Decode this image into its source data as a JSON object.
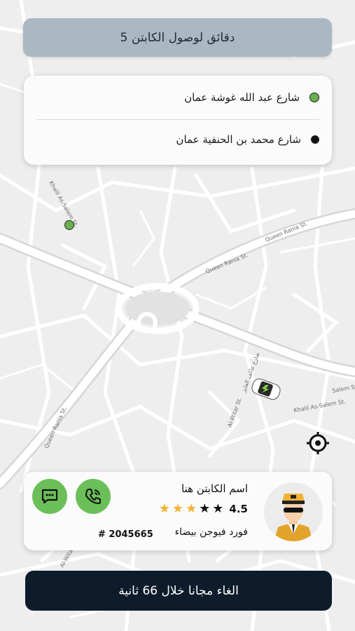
{
  "eta_banner": {
    "text": "5 دقائق لوصول الكابتن"
  },
  "route": {
    "pickup": "شارع عبد الله غوشة عمان",
    "dropoff": "شارع محمد بن الحنفية عمان"
  },
  "map": {
    "streets": [
      "Queen Rania St.",
      "Queen Rania St.",
      "Queen Rania St.",
      "Khalil As-Salem St.",
      "Khalil As-Salem St.",
      "Al-Witar St.",
      "Al-Witar St.",
      "شارع عاكف الفايز",
      "Salem St."
    ],
    "colors": {
      "road": "#ffffff",
      "block": "#ececec",
      "highway": "#dcdcdc"
    }
  },
  "captain": {
    "name": "اسم الكابتن هنا",
    "rating": "4.5",
    "stars": {
      "filled_gold": 3,
      "filled_dark": 2
    },
    "car": "فورد فيوجن بيضاء",
    "plate": "# 2045665"
  },
  "actions": {
    "chat_icon": "chat-icon",
    "call_icon": "phone-icon",
    "locate_icon": "crosshair-icon"
  },
  "cancel_button": {
    "label": "الغاء مجانا خلال 66 ثانية"
  },
  "colors": {
    "accent_green": "#6bbf59",
    "navy": "#0d1b2a",
    "banner": "#aab8c2",
    "star_gold": "#f2b233"
  }
}
